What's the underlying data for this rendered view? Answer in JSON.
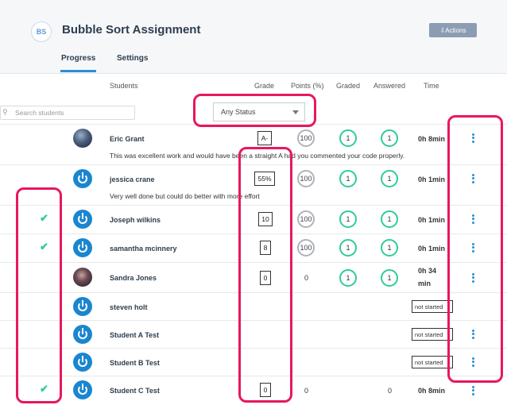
{
  "header": {
    "badge": "BS",
    "title": "Bubble Sort Assignment",
    "actions_label": "⇩Actions"
  },
  "tabs": [
    {
      "label": "Progress",
      "active": true
    },
    {
      "label": "Settings",
      "active": false
    }
  ],
  "columns": {
    "students": "Students",
    "grade": "Grade",
    "points": "Points (%)",
    "graded": "Graded",
    "answered": "Answered",
    "time": "Time"
  },
  "filters": {
    "search_placeholder": "Search students",
    "status_value": "Any Status"
  },
  "rows": [
    {
      "name": "Eric Grant",
      "grade": "A-",
      "points": "100",
      "graded": "1",
      "answered": "1",
      "time": "0h 8min",
      "comment": "This was excellent work and would have been a straight A had you commented your code properly.",
      "checked": false
    },
    {
      "name": "jessica crane",
      "grade": "55%",
      "points": "100",
      "graded": "1",
      "answered": "1",
      "time": "0h 1min",
      "comment": "Very well done but could do better with more effort",
      "checked": false
    },
    {
      "name": "Joseph wilkins",
      "grade": "10",
      "points": "100",
      "graded": "1",
      "answered": "1",
      "time": "0h 1min",
      "checked": true
    },
    {
      "name": "samantha mcinnery",
      "grade": "8",
      "points": "100",
      "graded": "1",
      "answered": "1",
      "time": "0h 1min",
      "checked": true
    },
    {
      "name": "Sandra Jones",
      "grade": "0",
      "points": "0",
      "graded": "1",
      "answered": "1",
      "time_line1": "0h 34",
      "time_line2": "min",
      "checked": false
    },
    {
      "name": "steven holt",
      "status": "not started",
      "checked": false
    },
    {
      "name": "Student A Test",
      "status": "not started",
      "checked": false
    },
    {
      "name": "Student B Test",
      "status": "not started",
      "checked": false
    },
    {
      "name": "Student C Test",
      "grade": "0",
      "points": "0",
      "answered": "0",
      "time": "0h 8min",
      "checked": true
    }
  ],
  "colors": {
    "accent_blue": "#2a8fd6",
    "highlight_pink": "#e8185c",
    "green": "#2ecc9a"
  }
}
